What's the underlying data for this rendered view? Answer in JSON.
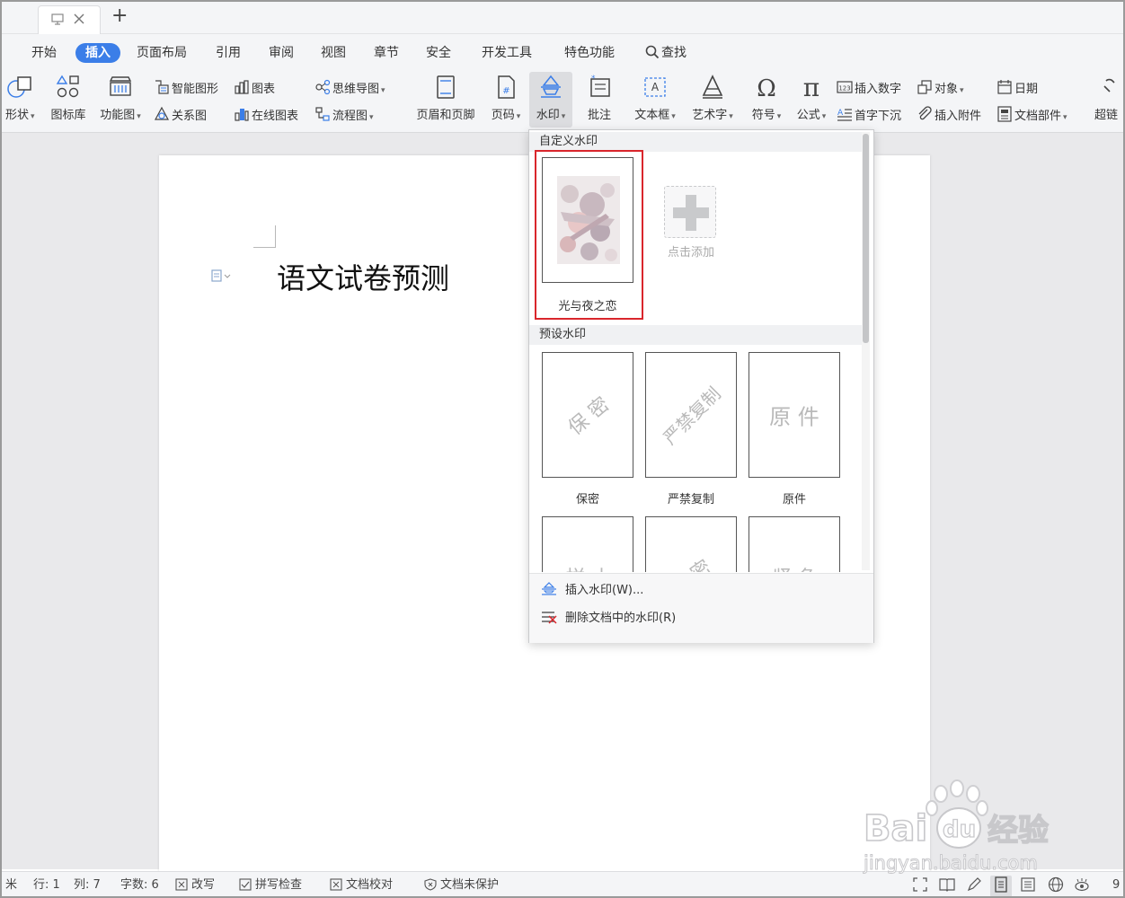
{
  "titlebar": {
    "new_tab_label": "+"
  },
  "menu": {
    "tabs": [
      "开始",
      "插入",
      "页面布局",
      "引用",
      "审阅",
      "视图",
      "章节",
      "安全",
      "开发工具",
      "特色功能"
    ],
    "active_tab": "插入",
    "search_label": "查找"
  },
  "ribbon": {
    "shape": "形状",
    "icon_lib": "图标库",
    "func_chart": "功能图",
    "smart_art": "智能图形",
    "relation": "关系图",
    "chart": "图表",
    "online_chart": "在线图表",
    "mind_map": "思维导图",
    "flow_chart": "流程图",
    "header_footer": "页眉和页脚",
    "page_number": "页码",
    "watermark": "水印",
    "comment": "批注",
    "text_box": "文本框",
    "word_art": "艺术字",
    "symbol": "符号",
    "formula": "公式",
    "insert_number": "插入数字",
    "drop_cap": "首字下沉",
    "object": "对象",
    "attachment": "插入附件",
    "date": "日期",
    "doc_parts": "文档部件",
    "hyperlink": "超链"
  },
  "document": {
    "title": "语文试卷预测"
  },
  "watermark_dropdown": {
    "custom_section": "自定义水印",
    "custom_items": [
      {
        "label": "光与夜之恋"
      }
    ],
    "add_label": "点击添加",
    "preset_section": "预设水印",
    "presets": [
      {
        "label": "保密",
        "text": "保 密"
      },
      {
        "label": "严禁复制",
        "text": "严禁复制"
      },
      {
        "label": "原件",
        "text": "原 件"
      }
    ],
    "partial_presets": [
      "样 本",
      "密",
      "紧 急"
    ],
    "actions": {
      "insert": "插入水印(W)...",
      "remove": "删除文档中的水印(R)"
    }
  },
  "statusbar": {
    "left_fragment": "米",
    "row": "行: 1",
    "col": "列: 7",
    "word_count": "字数: 6",
    "revise": "改写",
    "spell_check": "拼写检查",
    "doc_proof": "文档校对",
    "doc_protect": "文档未保护",
    "right_fragment": "9"
  },
  "watermark_logo": {
    "brand": "Baidu经验",
    "url": "jingyan.baidu.com"
  },
  "colors": {
    "accent": "#3b7ee8",
    "highlight": "#d9262c"
  }
}
